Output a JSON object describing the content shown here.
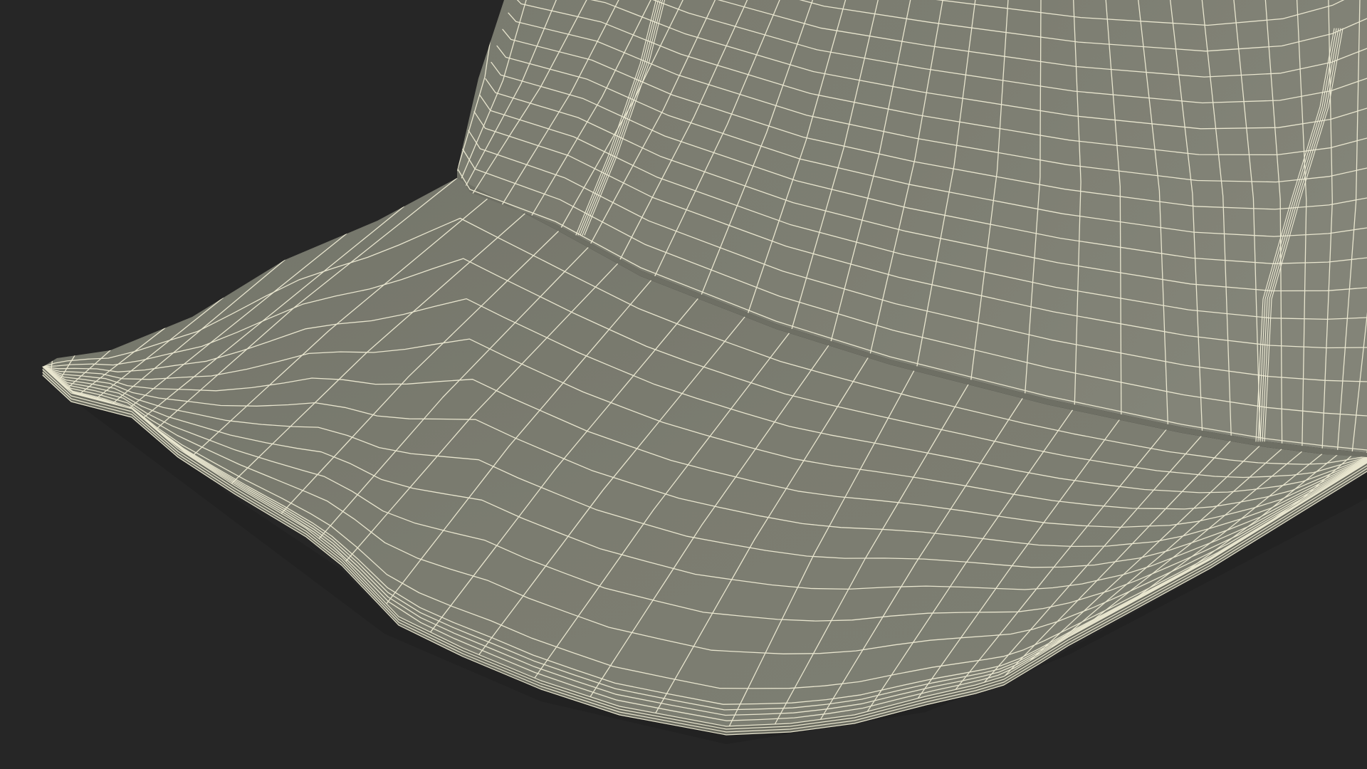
{
  "scene": {
    "subject": "cap-wireframe",
    "colors": {
      "background": "#262626",
      "surface": "#7a7b6f",
      "surface_dark": "#6c6d62",
      "surface_light": "#85867a",
      "wire": "#e9e6cf",
      "shadow": "#1e1e1e"
    }
  }
}
